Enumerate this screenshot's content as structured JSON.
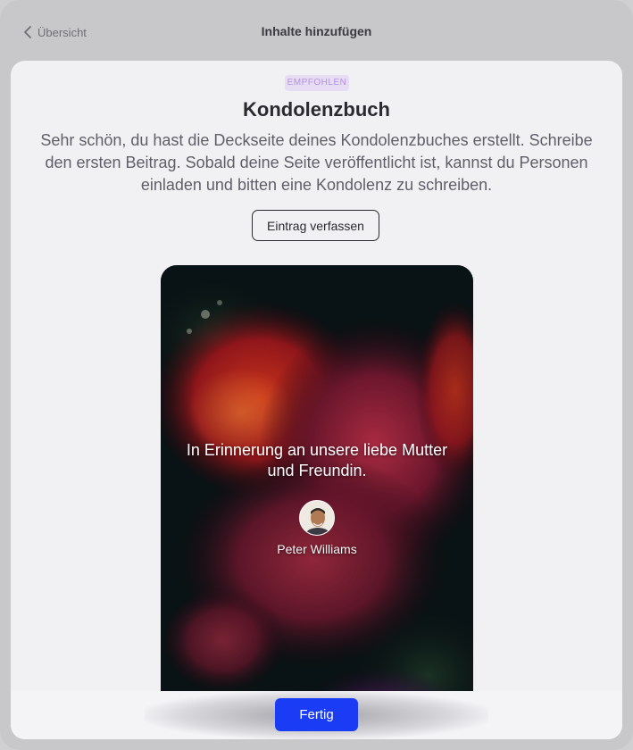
{
  "header": {
    "back_label": "Übersicht",
    "title": "Inhalte hinzufügen"
  },
  "main": {
    "badge": "EMPFOHLEN",
    "title": "Kondolenzbuch",
    "description": "Sehr schön, du hast die Deckseite deines Kondolenzbuches erstellt. Schreibe den ersten Beitrag. Sobald deine Seite veröffentlicht ist, kannst du Personen einladen und bitten eine Kondolenz zu schreiben.",
    "entry_button_label": "Eintrag verfassen"
  },
  "preview": {
    "memorial_text": "In Erinnerung an unsere liebe Mutter und Freundin.",
    "person_name": "Peter Williams"
  },
  "footer": {
    "done_label": "Fertig"
  },
  "colors": {
    "accent": "#1a3cf5",
    "badge_bg": "#e6dcf4",
    "badge_text": "#b391dd"
  }
}
